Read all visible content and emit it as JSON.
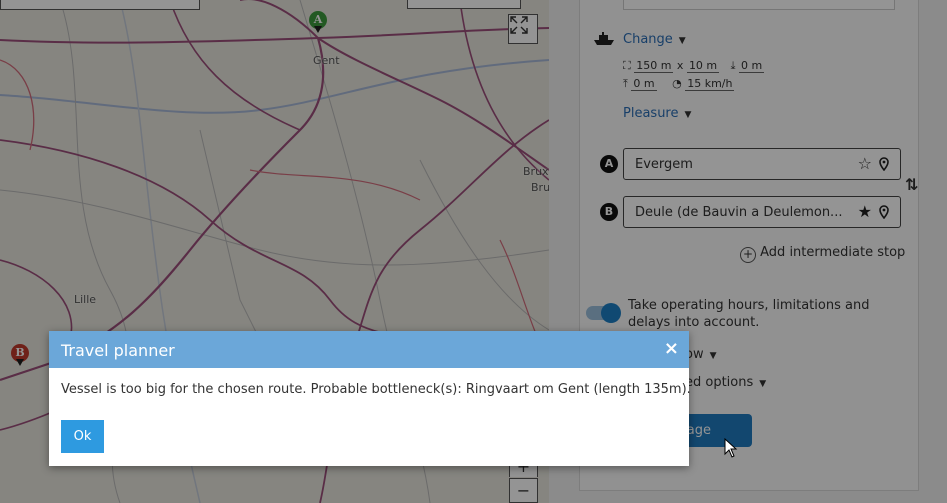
{
  "map": {
    "places": {
      "gent": "Gent",
      "brux1": "Brux",
      "brux2": "Bru",
      "lille": "Lille"
    },
    "markers": {
      "a": "A",
      "b": "B"
    },
    "controls": {
      "zoom_in": "+",
      "zoom_out": "−"
    },
    "colors": {
      "road": "#9b4f7a",
      "river": "#a8b8d8",
      "bg": "#e7e5dc"
    }
  },
  "panel": {
    "vessel": {
      "change_label": "Change",
      "length": "150 m",
      "times": "x",
      "width": "10 m",
      "draught": "0 m",
      "air_draught": "0 m",
      "speed": "15 km/h"
    },
    "vessel_type": "Pleasure",
    "route": {
      "from_marker": "A",
      "from_value": "Evergem",
      "to_marker": "B",
      "to_value": "Deule (de Bauvin a Deulemon...",
      "add_stop": "Add intermediate stop"
    },
    "operating_hours_label": "Take operating hours, limitations and delays into account.",
    "partial_option_1": "ow",
    "partial_option_2": "ed options",
    "calc_button_partial": "e voyage",
    "colors": {
      "accent": "#2a6db5",
      "toggle": "#1d7fc4"
    }
  },
  "dialog": {
    "title": "Travel planner",
    "close": "×",
    "message": "Vessel is too big for the chosen route. Probable bottleneck(s): Ringvaart om Gent (length 135m).",
    "ok_label": "Ok",
    "colors": {
      "header": "#6ba7d9",
      "button": "#2e9ae0"
    }
  }
}
